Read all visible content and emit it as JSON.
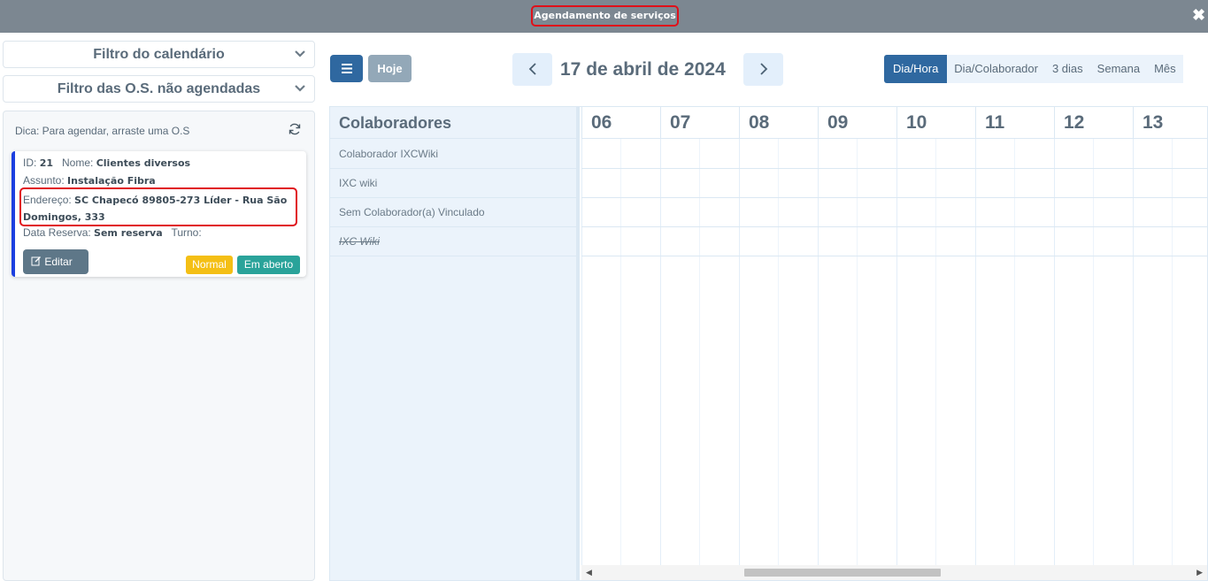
{
  "window": {
    "title": "Agendamento de serviços"
  },
  "sidebar": {
    "filters": [
      {
        "label": "Filtro do calendário"
      },
      {
        "label": "Filtro das O.S. não agendadas"
      }
    ],
    "pool": {
      "hint": "Dica: Para agendar, arraste uma O.S",
      "card": {
        "id_label": "ID:",
        "id_value": "21",
        "name_label": "Nome:",
        "name_value": "Clientes diversos",
        "subject_label": "Assunto:",
        "subject_value": "Instalação Fibra",
        "address_label": "Endereço:",
        "address_value": "SC Chapecó 89805-273 Líder - Rua São Domingos, 333",
        "reserve_label": "Data Reserva:",
        "reserve_value": "Sem reserva",
        "shift_label": "Turno:",
        "edit_label": "Editar",
        "priority_badge": "Normal",
        "status_badge": "Em aberto",
        "accent_color": "#1c3fe0"
      }
    }
  },
  "toolbar": {
    "today_label": "Hoje",
    "date_title": "17 de abril de 2024",
    "views": [
      "Dia/Hora",
      "Dia/Colaborador",
      "3 dias",
      "Semana",
      "Mês"
    ],
    "active_view": "Dia/Hora"
  },
  "calendar": {
    "resource_header": "Colaboradores",
    "resources": [
      "Colaborador IXCWiki",
      "IXC wiki",
      "Sem Colaborador(a) Vinculado",
      "IXC Wiki"
    ],
    "hours": [
      "06",
      "07",
      "08",
      "09",
      "10",
      "11",
      "12",
      "13"
    ]
  }
}
